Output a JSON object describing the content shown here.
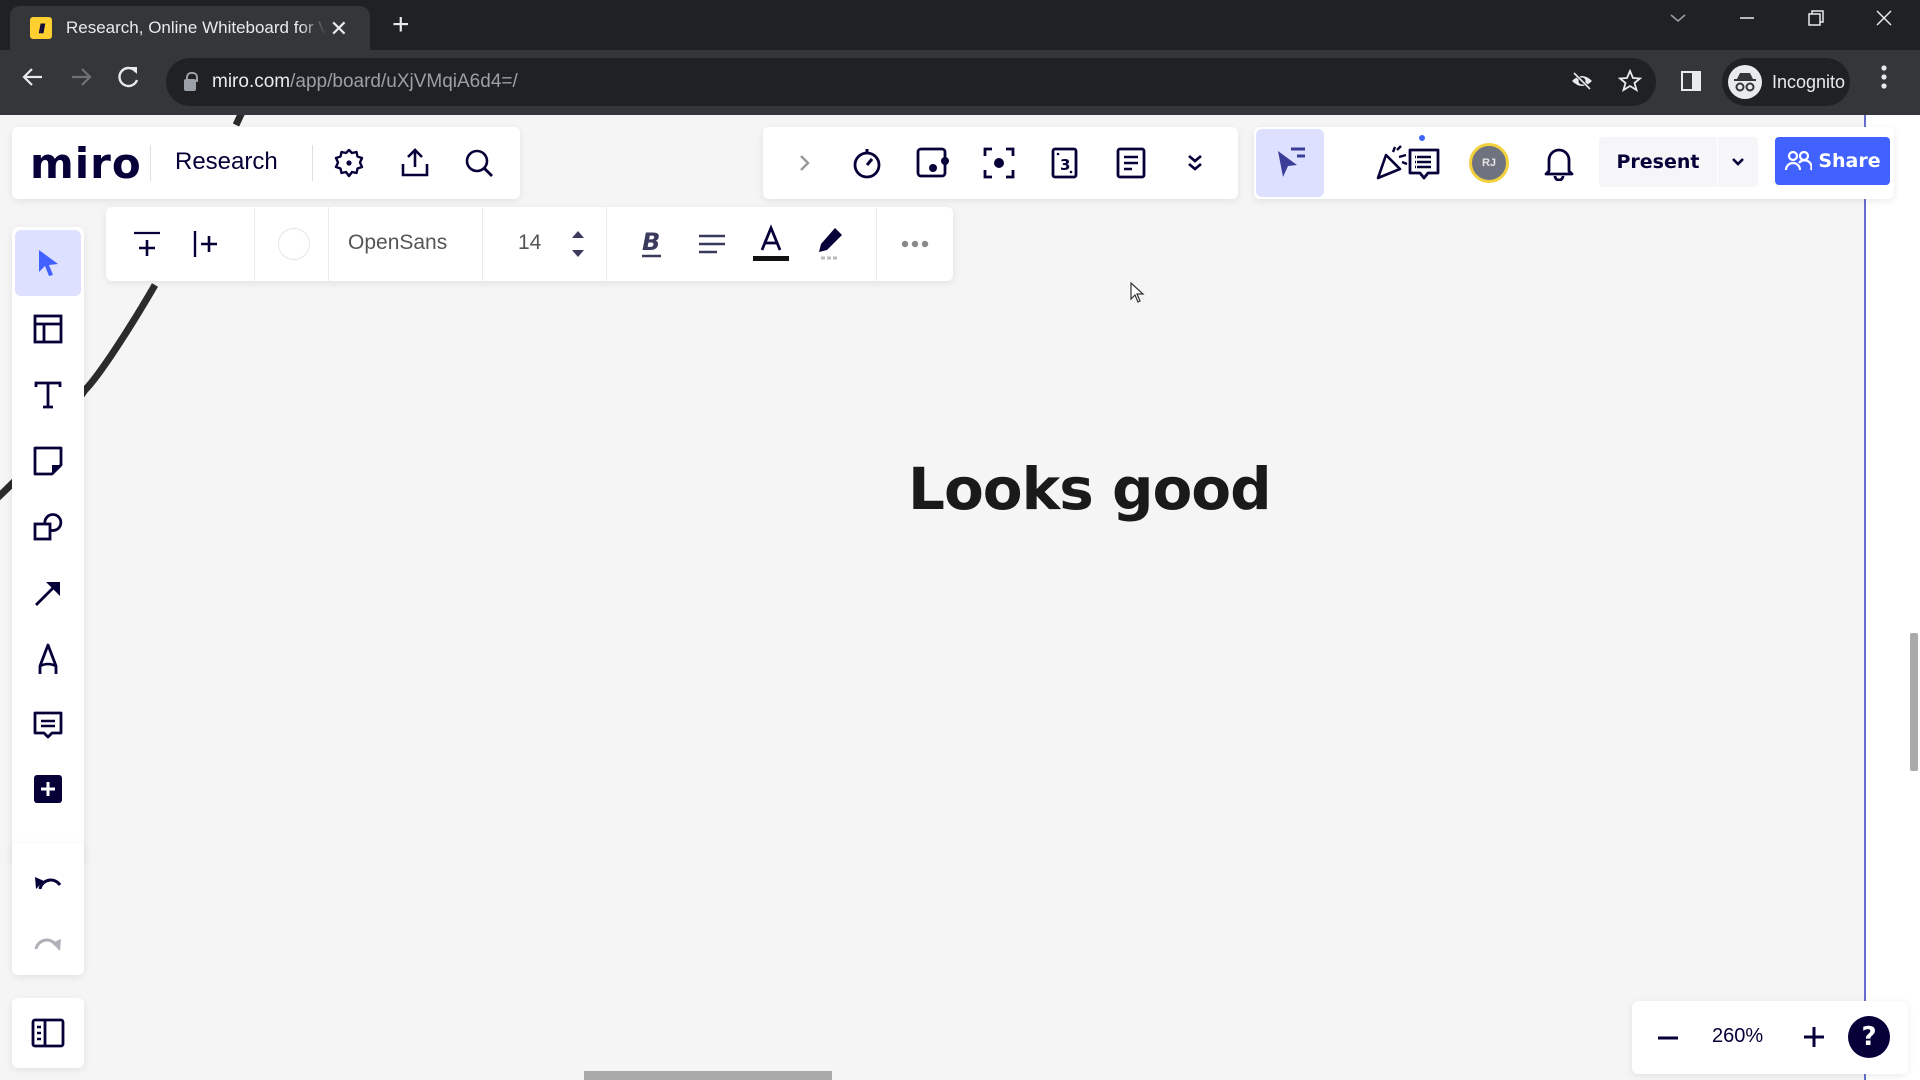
{
  "browser": {
    "tab_title": "Research, Online Whiteboard for Visual Collaboration",
    "favicon_label": "miro-favicon",
    "new_tab": "+",
    "url_host": "miro.com",
    "url_path": "/app/board/uXjVMqiA6d4=/",
    "profile_label": "Incognito"
  },
  "board_header": {
    "logo": "miro",
    "board_name": "Research"
  },
  "collab": {
    "avatar_initials": "RJ",
    "present_label": "Present",
    "share_label": "Share",
    "colors": {
      "accent": "#4262ff",
      "active_bg": "#dee0ff",
      "avatar_ring": "#f2d13e"
    }
  },
  "format_toolbar": {
    "font_name": "OpenSans",
    "font_size": "14",
    "text_color": "#000000",
    "fill_color": "#ffffff"
  },
  "canvas": {
    "text_item": "Looks good"
  },
  "left_tools": [
    {
      "name": "select",
      "active": true
    },
    {
      "name": "templates"
    },
    {
      "name": "text"
    },
    {
      "name": "sticky-note"
    },
    {
      "name": "shapes"
    },
    {
      "name": "connection-line"
    },
    {
      "name": "pen"
    },
    {
      "name": "comment"
    },
    {
      "name": "more-apps"
    }
  ],
  "zoom": {
    "level": "260%",
    "help": "?"
  }
}
